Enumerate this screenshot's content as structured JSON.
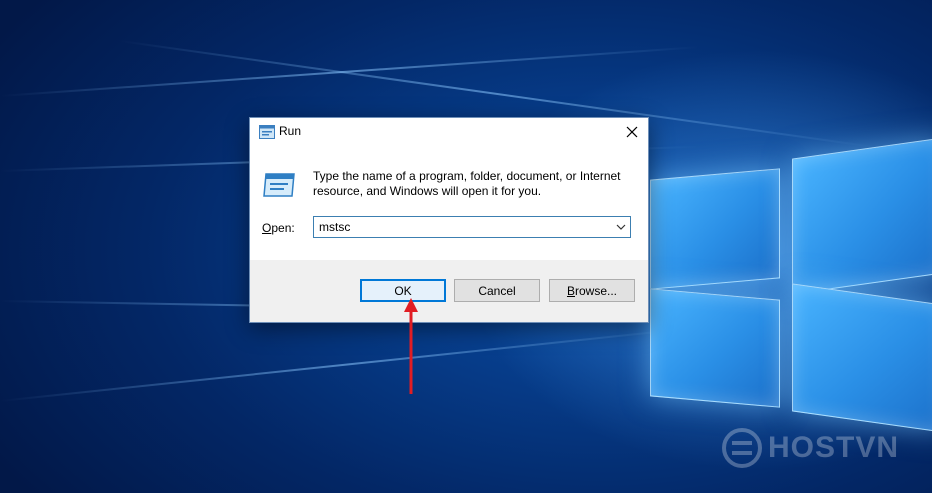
{
  "dialog": {
    "title": "Run",
    "description": "Type the name of a program, folder, document, or Internet resource, and Windows will open it for you.",
    "open_label_mnemonic": "O",
    "open_label_rest": "pen:",
    "open_value": "mstsc",
    "buttons": {
      "ok": "OK",
      "cancel": "Cancel",
      "browse_mnemonic": "B",
      "browse_rest": "rowse..."
    }
  },
  "watermark": {
    "text": "HOSTVN"
  },
  "colors": {
    "desktop_dark": "#032766",
    "desktop_glow": "#49b4ff",
    "accent": "#0078d7",
    "annotation_arrow": "#e11d23"
  },
  "icons": {
    "title_icon": "run-icon",
    "big_icon": "run-icon",
    "close": "close-icon",
    "dropdown": "chevron-down-icon"
  }
}
